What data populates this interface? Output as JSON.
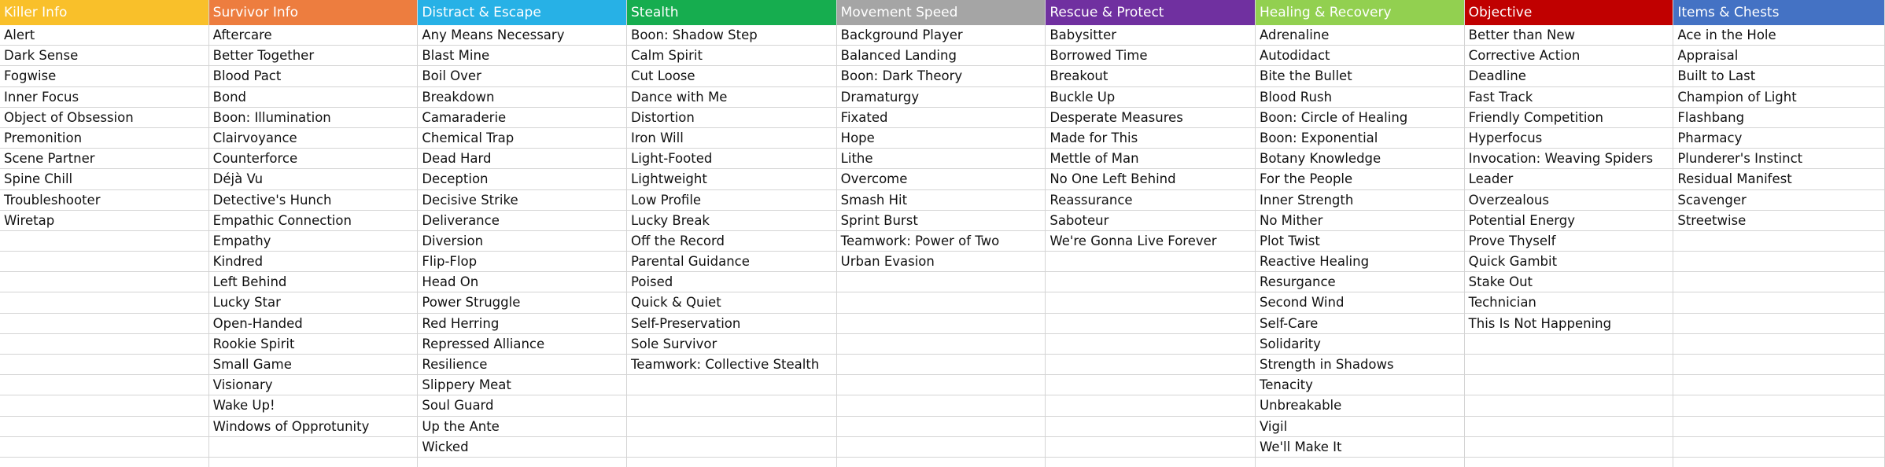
{
  "columns": [
    {
      "header": "Killer Info",
      "color": "#f9c02a",
      "items": [
        "Alert",
        "Dark Sense",
        "Fogwise",
        "Inner Focus",
        "Object of Obsession",
        "Premonition",
        "Scene Partner",
        "Spine Chill",
        "Troubleshooter",
        "Wiretap"
      ]
    },
    {
      "header": "Survivor Info",
      "color": "#ed7d3f",
      "items": [
        "Aftercare",
        "Better Together",
        "Blood Pact",
        "Bond",
        "Boon: Illumination",
        "Clairvoyance",
        "Counterforce",
        "Déjà Vu",
        "Detective's Hunch",
        "Empathic Connection",
        "Empathy",
        "Kindred",
        "Left Behind",
        "Lucky Star",
        "Open-Handed",
        "Rookie Spirit",
        "Small Game",
        "Visionary",
        "Wake Up!",
        "Windows of Opprotunity"
      ]
    },
    {
      "header": "Distract & Escape",
      "color": "#27b1e6",
      "items": [
        "Any Means Necessary",
        "Blast Mine",
        "Boil Over",
        "Breakdown",
        "Camaraderie",
        "Chemical Trap",
        "Dead Hard",
        "Deception",
        "Decisive Strike",
        "Deliverance",
        "Diversion",
        "Flip-Flop",
        "Head On",
        "Power Struggle",
        "Red Herring",
        "Repressed Alliance",
        "Resilience",
        "Slippery Meat",
        "Soul Guard",
        "Up the Ante",
        "Wicked"
      ]
    },
    {
      "header": "Stealth",
      "color": "#16ad4f",
      "items": [
        "Boon: Shadow Step",
        "Calm Spirit",
        "Cut Loose",
        "Dance with Me",
        "Distortion",
        "Iron Will",
        "Light-Footed",
        "Lightweight",
        "Low Profile",
        "Lucky Break",
        "Off the Record",
        "Parental Guidance",
        "Poised",
        "Quick & Quiet",
        "Self-Preservation",
        "Sole Survivor",
        "Teamwork: Collective Stealth"
      ]
    },
    {
      "header": "Movement Speed",
      "color": "#a5a5a5",
      "items": [
        "Background Player",
        "Balanced Landing",
        "Boon: Dark Theory",
        "Dramaturgy",
        "Fixated",
        "Hope",
        "Lithe",
        "Overcome",
        "Smash Hit",
        "Sprint Burst",
        "Teamwork: Power of Two",
        "Urban Evasion"
      ]
    },
    {
      "header": "Rescue & Protect",
      "color": "#7030a0",
      "items": [
        "Babysitter",
        "Borrowed Time",
        "Breakout",
        "Buckle Up",
        "Desperate Measures",
        "Made for This",
        "Mettle of Man",
        "No One Left Behind",
        "Reassurance",
        "Saboteur",
        "We're Gonna Live Forever"
      ]
    },
    {
      "header": "Healing & Recovery",
      "color": "#92d050",
      "items": [
        "Adrenaline",
        "Autodidact",
        "Bite the Bullet",
        "Blood Rush",
        "Boon: Circle of Healing",
        "Boon: Exponential",
        "Botany Knowledge",
        "For the People",
        "Inner Strength",
        "No Mither",
        "Plot Twist",
        "Reactive Healing",
        "Resurgance",
        "Second Wind",
        "Self-Care",
        "Solidarity",
        "Strength in Shadows",
        "Tenacity",
        "Unbreakable",
        "Vigil",
        "We'll Make It"
      ]
    },
    {
      "header": "Objective",
      "color": "#c00000",
      "items": [
        "Better than New",
        "Corrective Action",
        "Deadline",
        "Fast Track",
        "Friendly Competition",
        "Hyperfocus",
        "Invocation: Weaving Spiders",
        "Leader",
        "Overzealous",
        "Potential Energy",
        "Prove Thyself",
        "Quick Gambit",
        "Stake Out",
        "Technician",
        "This Is Not Happening"
      ]
    },
    {
      "header": "Items & Chests",
      "color": "#4472c4",
      "items": [
        "Ace in the Hole",
        "Appraisal",
        "Built to Last",
        "Champion of Light",
        "Flashbang",
        "Pharmacy",
        "Plunderer's Instinct",
        "Residual Manifest",
        "Scavenger",
        "Streetwise"
      ]
    }
  ]
}
